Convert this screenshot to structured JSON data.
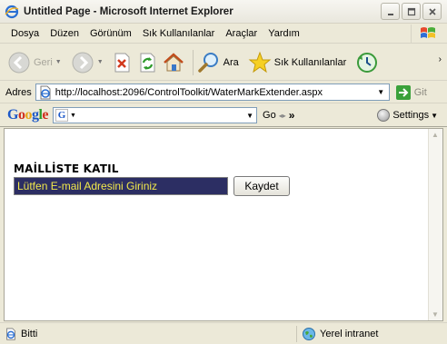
{
  "window": {
    "title": "Untitled Page - Microsoft Internet Explorer"
  },
  "menu": {
    "items": [
      "Dosya",
      "Düzen",
      "Görünüm",
      "Sık Kullanılanlar",
      "Araçlar",
      "Yardım"
    ]
  },
  "toolbar": {
    "back_label": "Geri",
    "search_label": "Ara",
    "favorites_label": "Sık Kullanılanlar",
    "overflow": "›"
  },
  "address": {
    "label": "Adres",
    "url": "http://localhost:2096/ControlToolkit/WaterMarkExtender.aspx",
    "go_label": "Git"
  },
  "google": {
    "logo": "Google",
    "go_label": "Go",
    "more": "»",
    "settings_label": "Settings"
  },
  "page": {
    "heading": "MAİLLİSTE KATIL",
    "email_watermark": "Lütfen E-mail Adresini Giriniz",
    "save_button": "Kaydet"
  },
  "status": {
    "text": "Bitti",
    "zone": "Yerel intranet"
  },
  "colors": {
    "watermark_bg": "#2c2e63",
    "watermark_text": "#f2e94b"
  }
}
